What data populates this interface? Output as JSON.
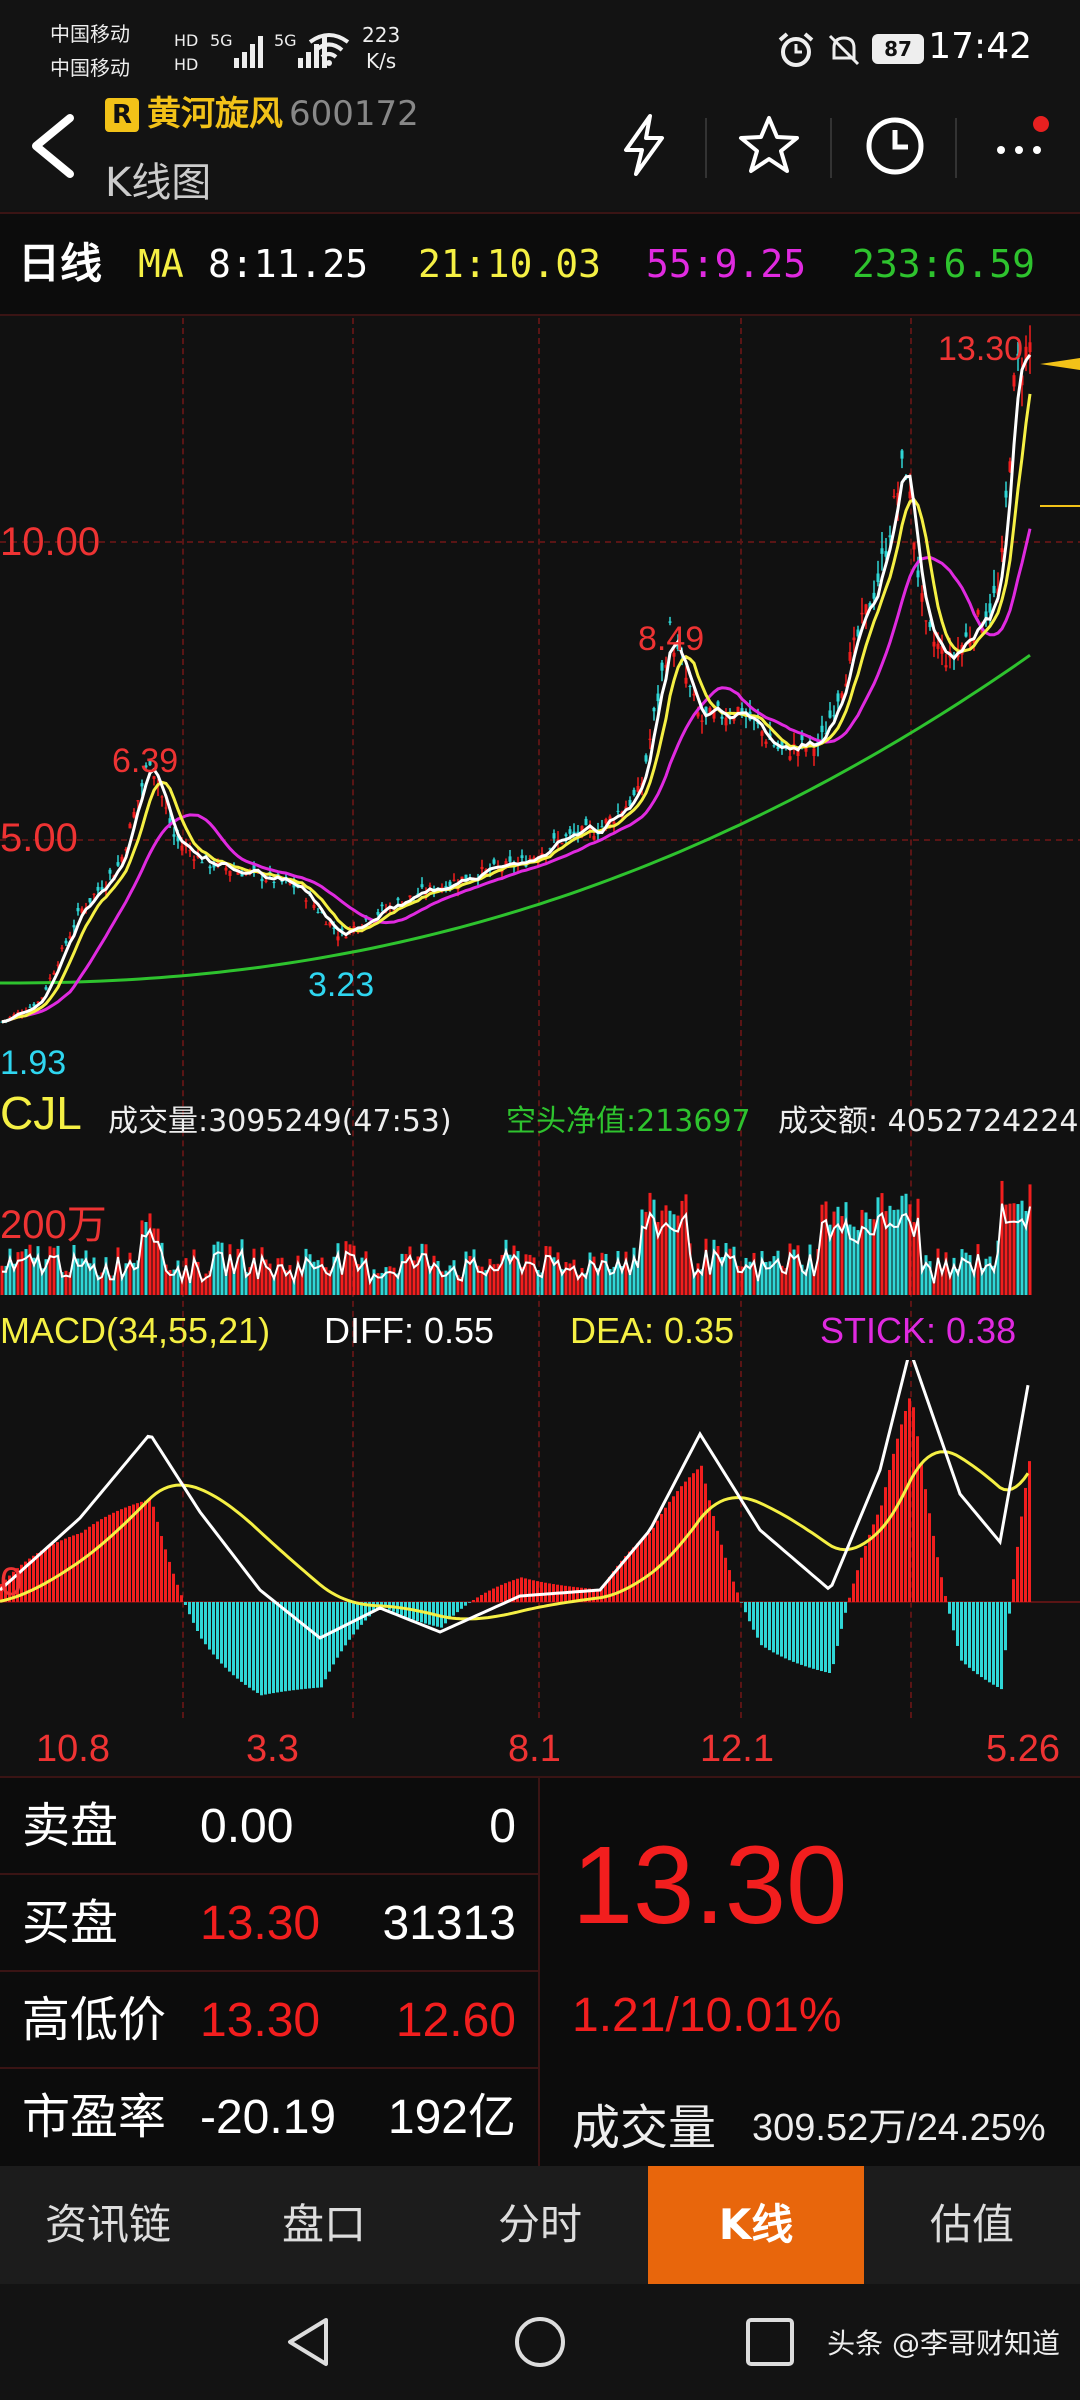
{
  "status_bar": {
    "carrier_1": "中国移动",
    "carrier_2": "中国移动",
    "network": "5G",
    "speed_value": "223",
    "speed_unit": "K/s",
    "battery": "87",
    "time": "17:42"
  },
  "header": {
    "badge": "R",
    "stock_name": "黄河旋风",
    "stock_code": "600172",
    "subtitle": "K线图",
    "icons": [
      "back-icon",
      "flash-icon",
      "star-icon",
      "clock-icon",
      "more-icon"
    ]
  },
  "ma_bar": {
    "period": "日线",
    "label": "MA",
    "ma8": "8:11.25",
    "ma21": "21:10.03",
    "ma55": "55:9.25",
    "ma233": "233:6.59"
  },
  "price_chart": {
    "high_label": "13.30",
    "level_10": "10.00",
    "level_5": "5.00",
    "peak_1": "6.39",
    "peak_2": "8.49",
    "low_1": "3.23",
    "low_start": "1.93"
  },
  "cjl": {
    "name": "CJL",
    "volume": "成交量:3095249(47:53)",
    "net": "空头净值:213697",
    "amount": "成交额: 4052724224",
    "scale": "200万"
  },
  "macd": {
    "name": "MACD(34,55,21)",
    "diff": "DIFF: 0.55",
    "dea": "DEA: 0.35",
    "stick": "STICK: 0.38",
    "zero": "0"
  },
  "dates": [
    "10.8",
    "3.3",
    "8.1",
    "12.1",
    "5.26"
  ],
  "quote": {
    "sell_label": "卖盘",
    "sell_price": "0.00",
    "sell_qty": "0",
    "buy_label": "买盘",
    "buy_price": "13.30",
    "buy_qty": "31313",
    "hl_label": "高低价",
    "high": "13.30",
    "low": "12.60",
    "pe_label": "市盈率",
    "pe": "-20.19",
    "mcap": "192亿",
    "last": "13.30",
    "change": "1.21/10.01%",
    "vol_label": "成交量",
    "vol_value": "309.52万/24.25%"
  },
  "tabs": [
    "资讯链",
    "盘口",
    "分时",
    "K线",
    "估值"
  ],
  "active_tab": "K线",
  "watermark": "头条 @李哥财知道",
  "colors": {
    "up": "#f21e1e",
    "accent": "#e8660c",
    "ma8": "#ffffff",
    "ma21": "#f5f044",
    "ma55": "#e02ae0",
    "ma233": "#2ec32e",
    "down": "#2fd6d6"
  }
}
